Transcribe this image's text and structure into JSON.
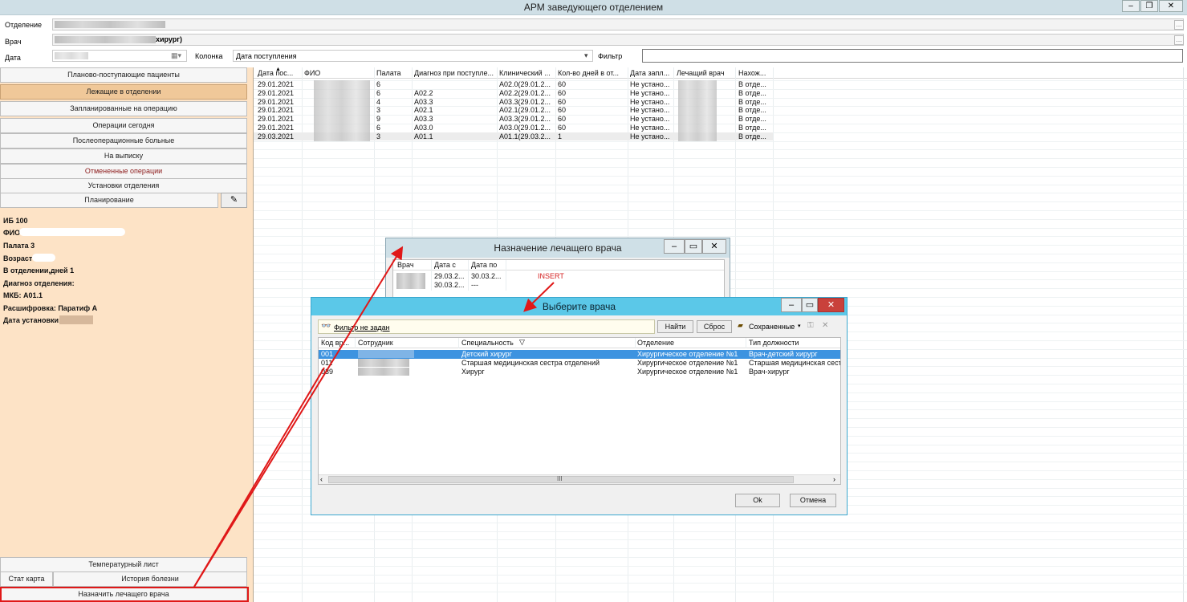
{
  "app": {
    "title": "АРМ заведующего отделением",
    "minimize": "–",
    "maximize": "❐",
    "close": "✕"
  },
  "header": {
    "department_label": "Отделение",
    "doctor_label": "Врач",
    "doctor_value": "хирург)",
    "date_label": "Дата",
    "column_label": "Колонка",
    "column_value": "Дата поступления",
    "filter_label": "Фильтр",
    "filter_value": ""
  },
  "left": {
    "buttons": [
      "Планово-поступающие пациенты",
      "Лежащие в отделении",
      "Запланированные на операцию",
      "Операции сегодня",
      "Послеоперационные больные",
      "На выписку",
      "Отмененные операции",
      "Установки отделения",
      "Планирование"
    ],
    "info": {
      "ib": "ИБ 100",
      "fio": "ФИО",
      "ward": "Палата 3",
      "age": "Возраст",
      "days": "В отделении,дней 1",
      "diag": "Диагноз отделения:",
      "mkb": "МКБ: А01.1",
      "decode": "Расшифровка: Паратиф А",
      "setdate": "Дата установки:"
    },
    "bottom": {
      "temp": "Температурный лист",
      "stat": "Стат карта",
      "history": "История болезни",
      "assign": "Назначить лечащего врача"
    }
  },
  "grid": {
    "columns": [
      "Дата пос...",
      "ФИО",
      "Палата",
      "Диагноз при поступле...",
      "Клинический ...",
      "Кол-во дней в от...",
      "Дата запл...",
      "Лечащий врач",
      "Нахож..."
    ],
    "rows": [
      [
        "29.01.2021",
        "",
        "6",
        "",
        "А02.0(29.01.2...",
        "60",
        "Не устано...",
        "",
        "В отде..."
      ],
      [
        "29.01.2021",
        "",
        "6",
        "А02.2",
        "А02.2(29.01.2...",
        "60",
        "Не устано...",
        "",
        "В отде..."
      ],
      [
        "29.01.2021",
        "",
        "4",
        "А03.3",
        "А03.3(29.01.2...",
        "60",
        "Не устано...",
        "",
        "В отде..."
      ],
      [
        "29.01.2021",
        "",
        "3",
        "А02.1",
        "А02.1(29.01.2...",
        "60",
        "Не устано...",
        "",
        "В отде..."
      ],
      [
        "29.01.2021",
        "",
        "9",
        "А03.3",
        "А03.3(29.01.2...",
        "60",
        "Не устано...",
        "",
        "В отде..."
      ],
      [
        "29.01.2021",
        "",
        "6",
        "А03.0",
        "А03.0(29.01.2...",
        "60",
        "Не устано...",
        "",
        "В отде..."
      ],
      [
        "29.03.2021",
        "",
        "3",
        "А01.1",
        "А01.1(29.03.2...",
        "1",
        "Не устано...",
        "",
        "В отде..."
      ]
    ]
  },
  "dialog1": {
    "title": "Назначение лечащего врача",
    "columns": [
      "Врач",
      "Дата с",
      "Дата по"
    ],
    "rows": [
      [
        "29.03.2...",
        "30.03.2..."
      ],
      [
        "30.03.2...",
        "---"
      ]
    ],
    "insert": "INSERT"
  },
  "dialog2": {
    "title": "Выберите врача",
    "filter_text": "Фильтр не задан",
    "find": "Найти",
    "reset": "Сброс",
    "saved": "Сохраненные",
    "columns": [
      "Код вр...",
      "Сотрудник",
      "Специальность",
      "Отделение",
      "Тип должности"
    ],
    "rows": [
      {
        "code": "001",
        "spec": "Детский хирург",
        "dept": "Хирургическое отделение №1",
        "type": "Врач-детский хирург"
      },
      {
        "code": "011",
        "spec": "Старшая медицинская сестра отделений",
        "dept": "Хирургическое отделение №1",
        "type": "Старшая медицинская сестра"
      },
      {
        "code": "039",
        "spec": "Хирург",
        "dept": "Хирургическое отделение №1",
        "type": "Врач-хирург"
      }
    ],
    "scroll_mid": "III",
    "ok": "Ok",
    "cancel": "Отмена"
  }
}
